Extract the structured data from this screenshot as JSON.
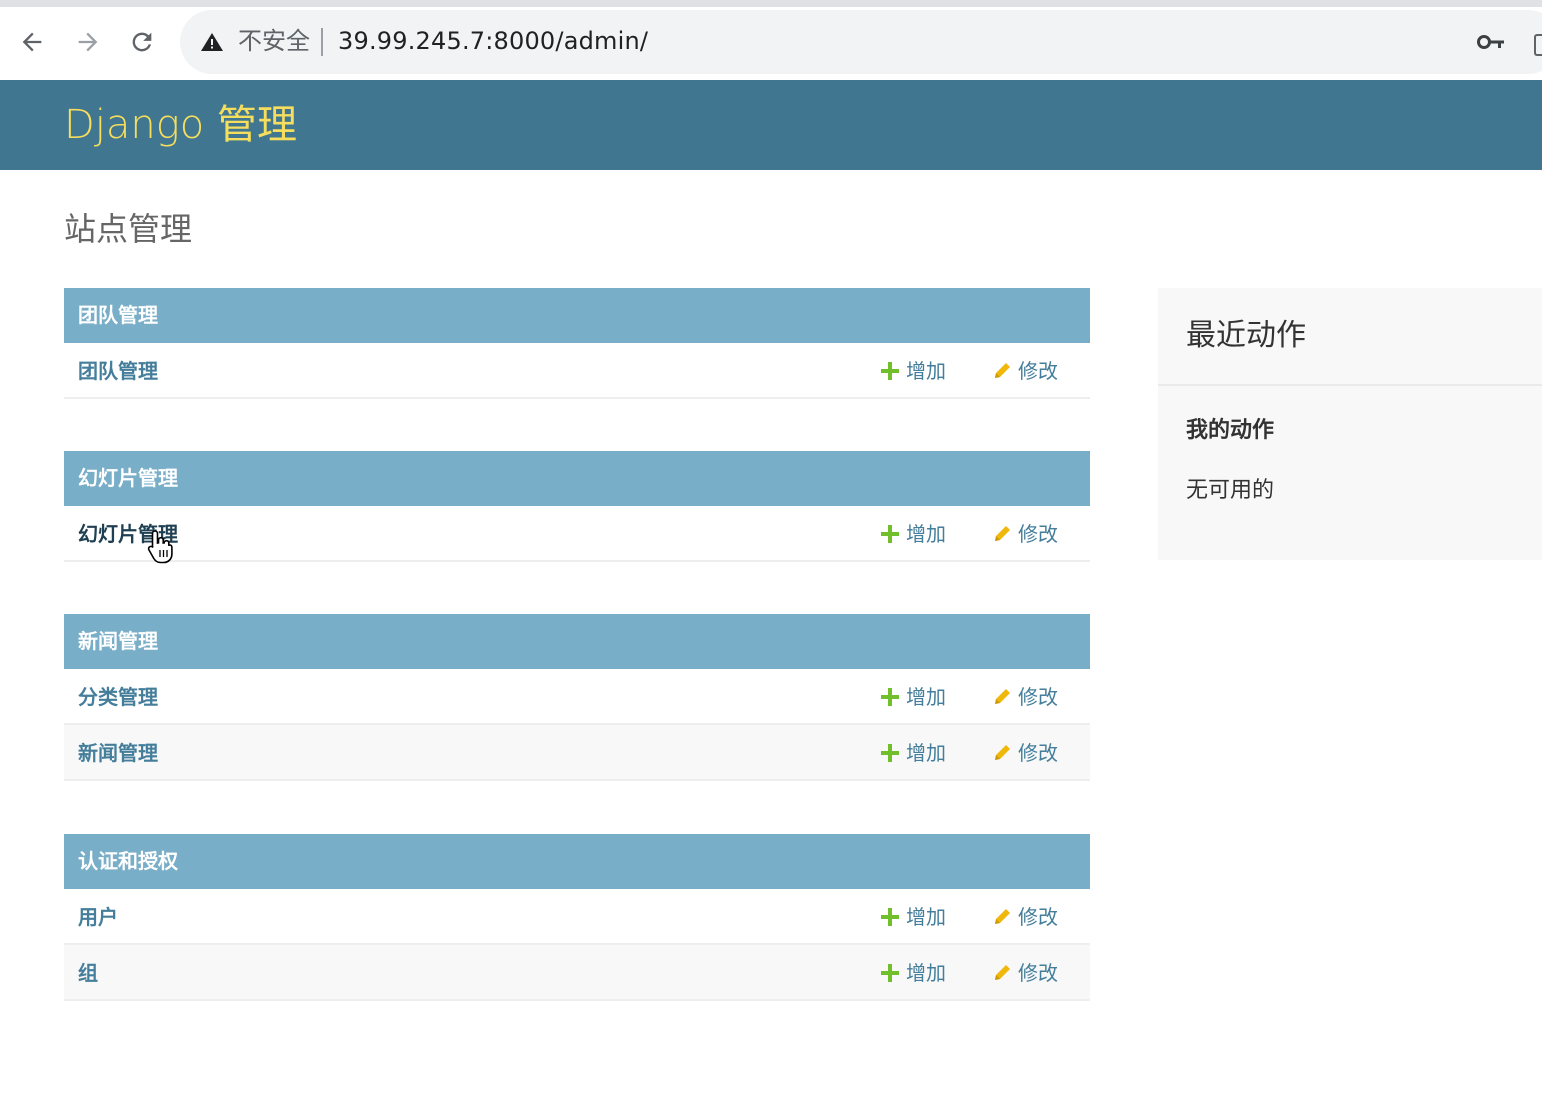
{
  "browser": {
    "security_label": "不安全",
    "url": "39.99.245.7:8000/admin/"
  },
  "header": {
    "branding": "Django 管理"
  },
  "page_title": "站点管理",
  "modules": [
    {
      "caption": "团队管理",
      "rows": [
        {
          "label": "团队管理",
          "add": "增加",
          "change": "修改"
        }
      ]
    },
    {
      "caption": "幻灯片管理",
      "rows": [
        {
          "label": "幻灯片管理",
          "add": "增加",
          "change": "修改"
        }
      ]
    },
    {
      "caption": "新闻管理",
      "rows": [
        {
          "label": "分类管理",
          "add": "增加",
          "change": "修改"
        },
        {
          "label": "新闻管理",
          "add": "增加",
          "change": "修改"
        }
      ]
    },
    {
      "caption": "认证和授权",
      "rows": [
        {
          "label": "用户",
          "add": "增加",
          "change": "修改"
        },
        {
          "label": "组",
          "add": "增加",
          "change": "修改"
        }
      ]
    }
  ],
  "recent_actions": {
    "title": "最近动作",
    "my_actions": "我的动作",
    "empty": "无可用的"
  },
  "colors": {
    "header_bg": "#417690",
    "branding": "#f5dd5d",
    "module_caption": "#79aec8",
    "link": "#447e9b",
    "add_icon": "#70bf2b",
    "change_icon": "#efb80b"
  },
  "icons": {
    "add": "plus-icon",
    "change": "pencil-icon"
  }
}
